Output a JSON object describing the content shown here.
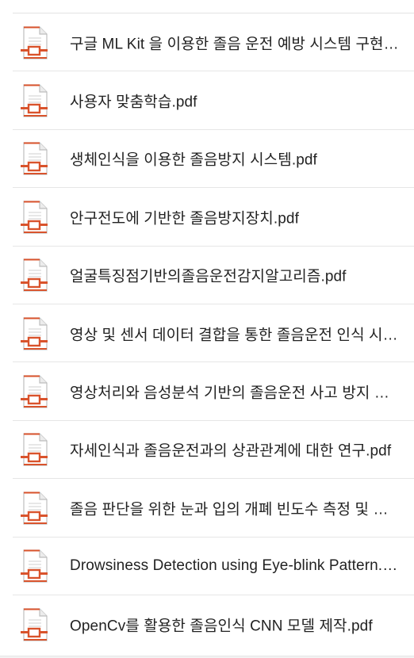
{
  "colors": {
    "pdf_icon_accent": "#d9532c",
    "pdf_icon_paper": "#ffffff",
    "pdf_icon_outline": "#bdbdbd",
    "text": "#222222",
    "divider": "#e6e6e6"
  },
  "file_icon": "pdf-document-icon",
  "files": [
    {
      "name": "구글 ML Kit 을 이용한 졸음 운전 예방 시스템 구현.pdf"
    },
    {
      "name": "사용자 맞춤학습.pdf"
    },
    {
      "name": "생체인식을 이용한 졸음방지 시스템.pdf"
    },
    {
      "name": "안구전도에 기반한 졸음방지장치.pdf"
    },
    {
      "name": "얼굴특징점기반의졸음운전감지알고리즘.pdf"
    },
    {
      "name": "영상 및 센서 데이터 결합을 통한 졸음운전 인식 시스템.pdf"
    },
    {
      "name": "영상처리와 음성분석 기반의 졸음운전 사고 방지 시스템.pdf"
    },
    {
      "name": "자세인식과 졸음운전과의 상관관계에 대한 연구.pdf"
    },
    {
      "name": "졸음 판단을 위한 눈과 입의 개폐 빈도수 측정 및 분석.pdf"
    },
    {
      "name": "Drowsiness Detection using Eye-blink Pattern.pdf"
    },
    {
      "name": "OpenCv를 활용한 졸음인식 CNN 모델 제작.pdf"
    }
  ]
}
